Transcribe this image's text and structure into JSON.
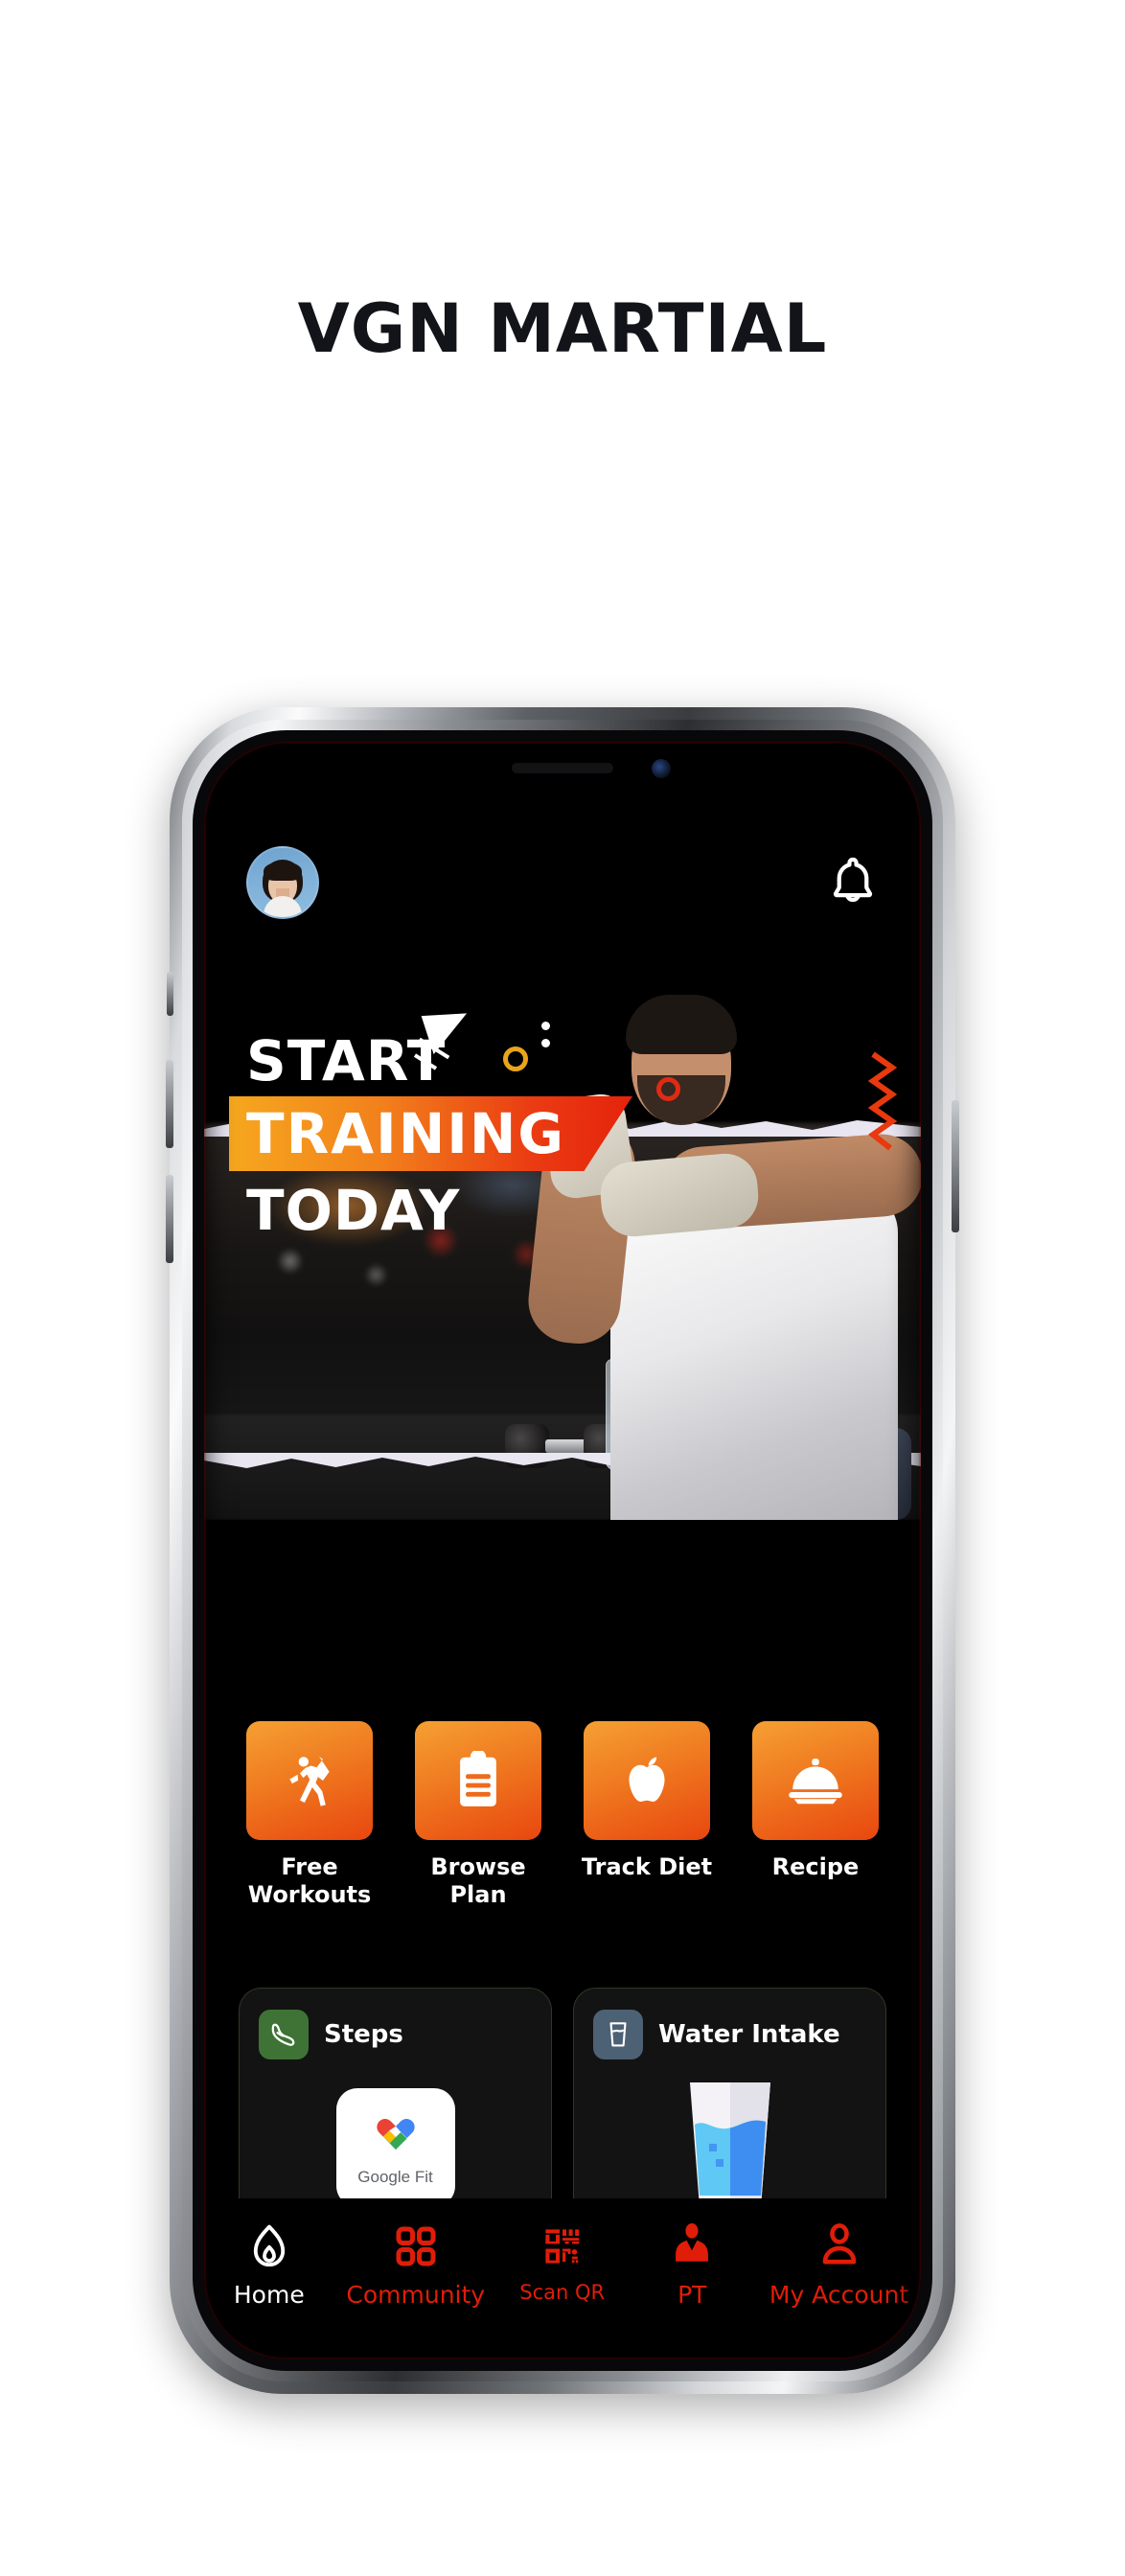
{
  "page": {
    "title": "VGN MARTIAL"
  },
  "app": {
    "header": {
      "avatar_name": "user-avatar",
      "notification_icon": "bell-icon"
    },
    "hero": {
      "line1": "START",
      "line2": "TRAINING",
      "line3": "TODAY",
      "band_gradient_from": "#f6a71e",
      "band_gradient_to": "#e5230c",
      "decor": {
        "ring_yellow": "#e8a51c",
        "ring_red": "#e02b13",
        "zigzag_red": "#e8390f"
      }
    },
    "actions": [
      {
        "label": "Free\nWorkouts",
        "label_line1": "Free",
        "label_line2": "Workouts",
        "icon": "exercise-person-icon"
      },
      {
        "label": "Browse\nPlan",
        "label_line1": "Browse",
        "label_line2": "Plan",
        "icon": "clipboard-icon"
      },
      {
        "label": "Track Diet",
        "label_line1": "Track Diet",
        "label_line2": "",
        "icon": "apple-icon"
      },
      {
        "label": "Recipe",
        "label_line1": "Recipe",
        "label_line2": "",
        "icon": "food-dome-icon"
      }
    ],
    "action_tile_gradient_from": "#f5a033",
    "action_tile_gradient_to": "#e8470f",
    "cards": [
      {
        "title": "Steps",
        "icon": "running-shoe-icon",
        "icon_bg": "#3f7335",
        "widget_label": "Google Fit",
        "widget_icon": "google-fit-heart-icon"
      },
      {
        "title": "Water Intake",
        "icon": "water-glass-icon",
        "icon_bg": "#4d6175",
        "widget_label": "",
        "widget_icon": "water-glass-illustration"
      }
    ],
    "bottom_nav": {
      "active_color": "#ffffff",
      "inactive_color": "#e01d08",
      "items": [
        {
          "label": "Home",
          "icon": "home-icon",
          "active": true
        },
        {
          "label": "Community",
          "icon": "grid-squares-icon",
          "active": false
        },
        {
          "label": "Scan QR",
          "icon": "qr-code-icon",
          "active": false
        },
        {
          "label": "PT",
          "icon": "trainer-person-icon",
          "active": false
        },
        {
          "label": "My Account",
          "icon": "user-person-icon",
          "active": false
        }
      ]
    }
  }
}
